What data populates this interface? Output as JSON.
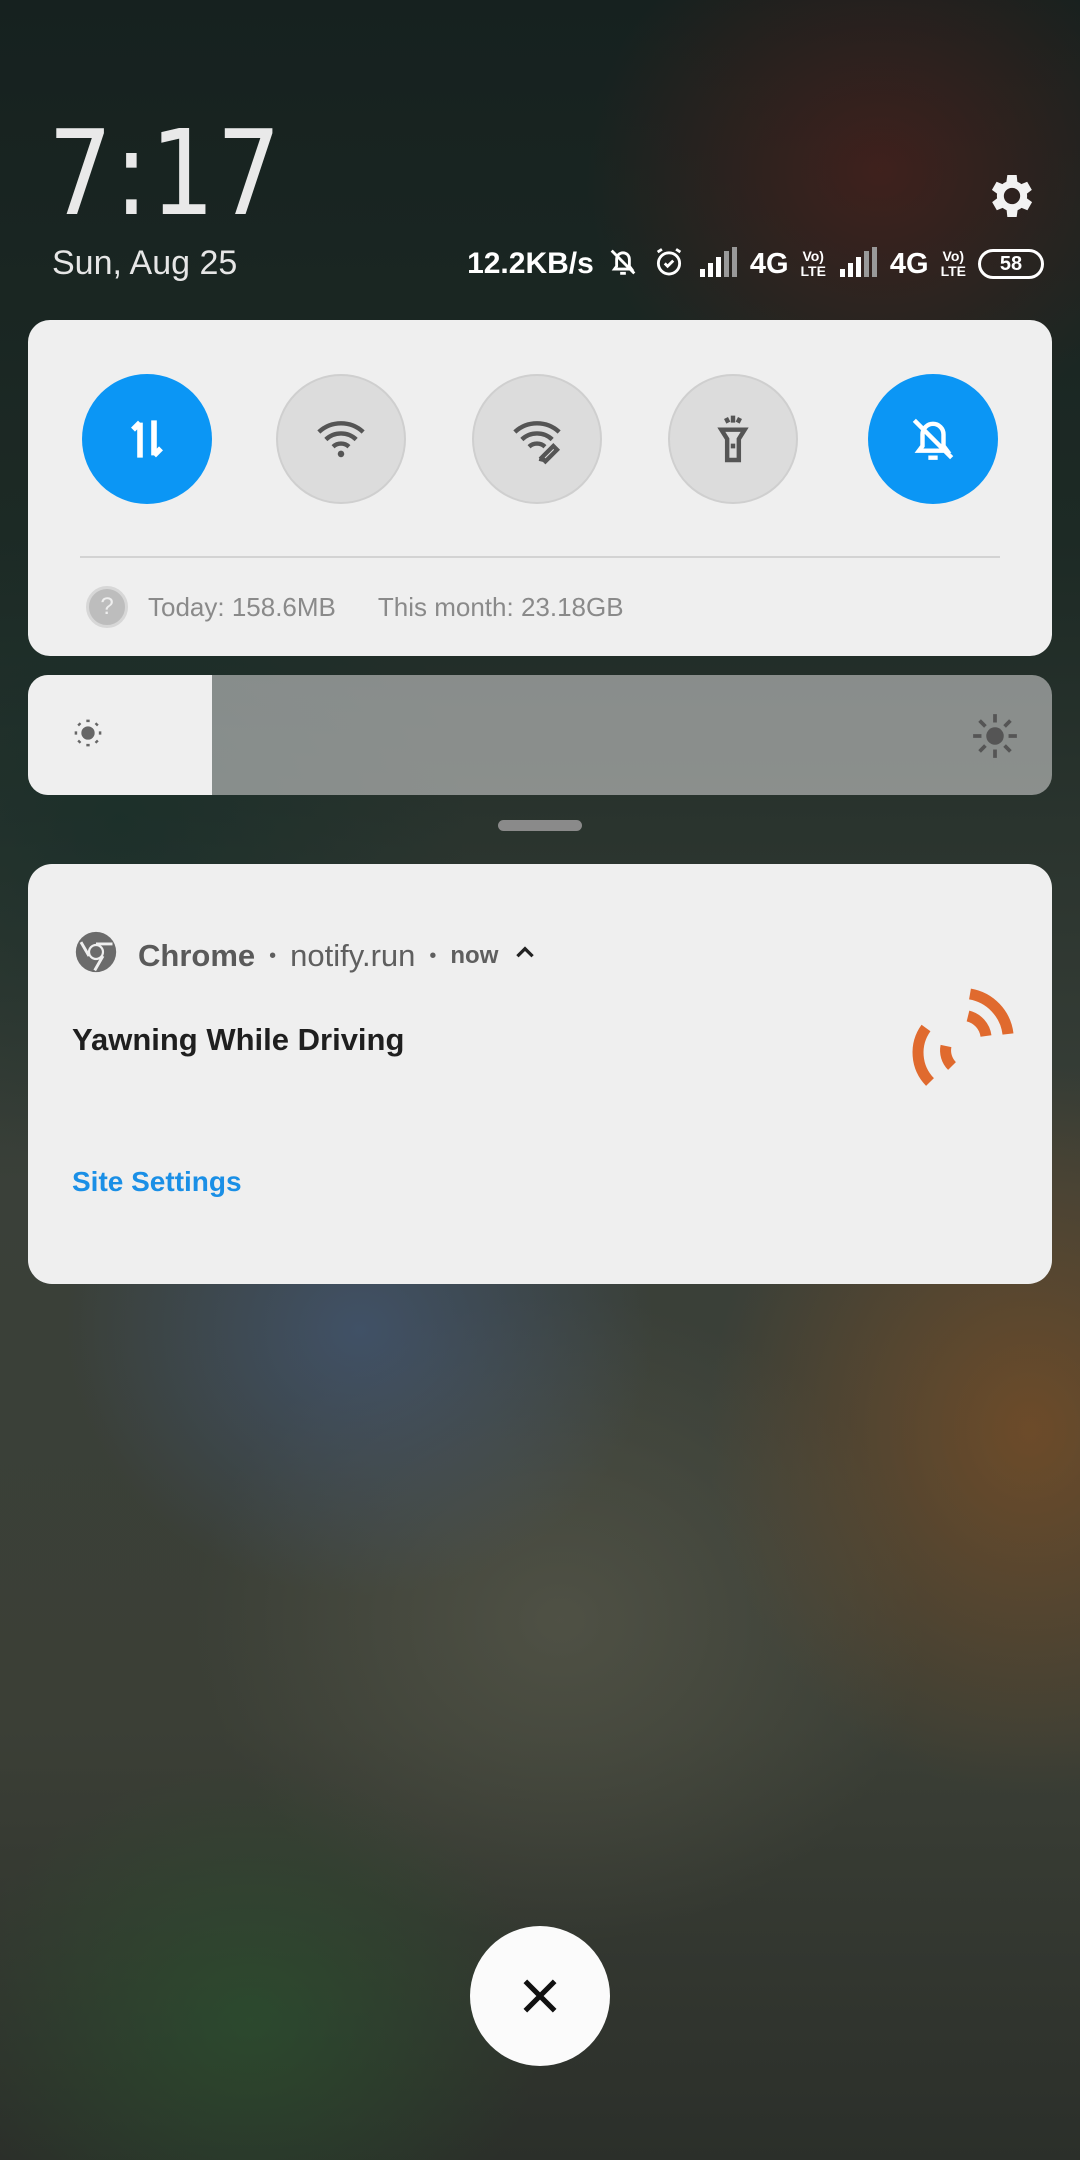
{
  "header": {
    "time": "7:17",
    "date": "Sun, Aug 25",
    "settings_icon": "gear-icon"
  },
  "status_bar": {
    "net_speed": "12.2KB/s",
    "icons": [
      "mute-bell-icon",
      "alarm-icon",
      "signal-icon",
      "signal-icon"
    ],
    "network_1": "4G",
    "network_2": "4G",
    "volte_top": "Vo)",
    "volte_bottom": "LTE",
    "battery": "58"
  },
  "quick_settings": {
    "toggles": [
      {
        "name": "mobile-data",
        "icon": "data-transfer-icon",
        "state": "on"
      },
      {
        "name": "wifi",
        "icon": "wifi-icon",
        "state": "off"
      },
      {
        "name": "hotspot",
        "icon": "wifi-hotspot-icon",
        "state": "off"
      },
      {
        "name": "flashlight",
        "icon": "flashlight-icon",
        "state": "off"
      },
      {
        "name": "silent",
        "icon": "mute-bell-icon",
        "state": "on"
      }
    ],
    "usage_today": "Today: 158.6MB",
    "usage_month": "This month: 23.18GB",
    "help_glyph": "?"
  },
  "brightness": {
    "level": 0.18
  },
  "notification": {
    "app": "Chrome",
    "source": "notify.run",
    "time": "now",
    "title": "Yawning While Driving",
    "action": "Site Settings",
    "accent_color": "#e06a2e"
  },
  "colors": {
    "accent": "#0b96f5",
    "link": "#1a8fe6"
  },
  "close_icon": "close-icon"
}
